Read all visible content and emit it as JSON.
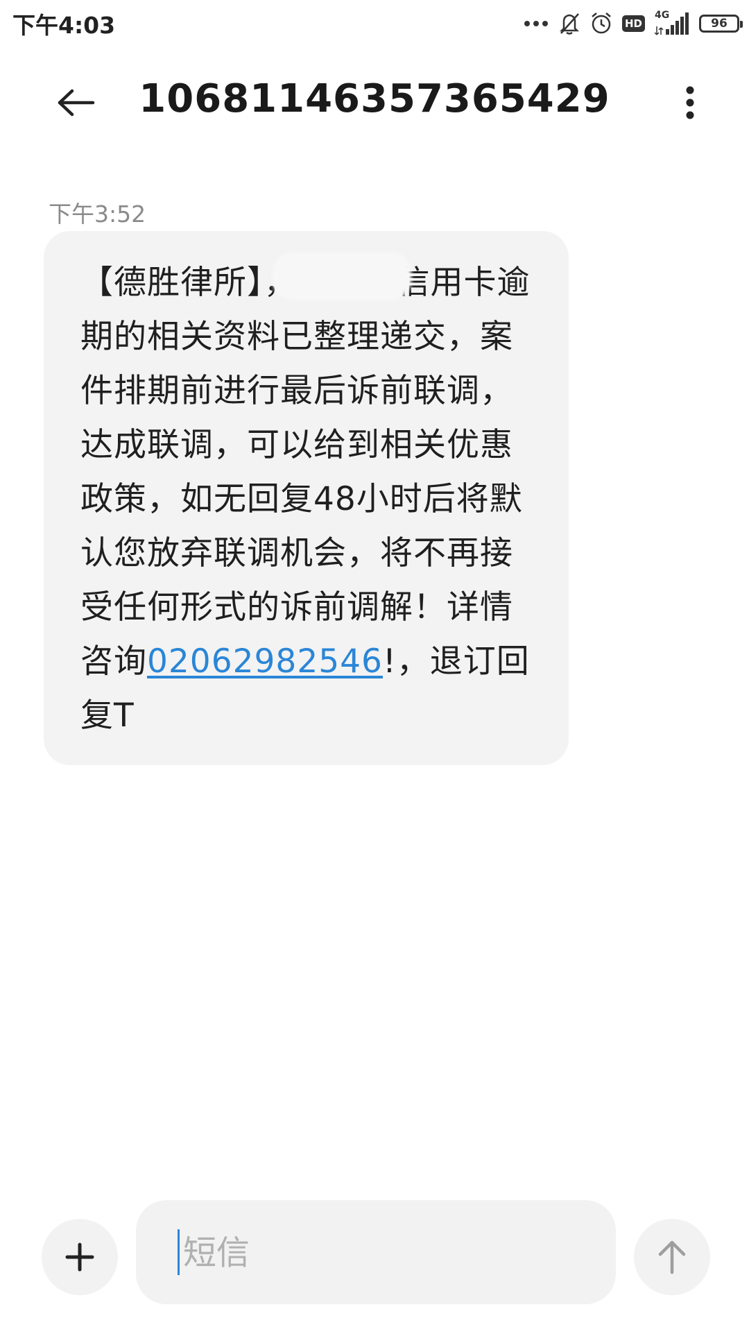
{
  "status_bar": {
    "time": "下午4:03",
    "network": "4G",
    "hd": "HD",
    "battery_text": "96",
    "battery_level": 0.96
  },
  "header": {
    "title": "10681146357365429",
    "back_icon": "arrow-left-icon",
    "more_icon": "more-vertical-icon"
  },
  "message": {
    "time": "下午3:52",
    "text_before_link": "【德胜律所】，关于您信用卡逾期的相关资料已整理递交，案件排期前进行最后诉前联调，达成联调，可以给到相关优惠政策，如无回复48小时后将默认您放弃联调机会，将不再接受任何形式的诉前调解！详情咨询",
    "phone_link": "02062982546",
    "text_after_link": "!，退订回复T"
  },
  "composer": {
    "placeholder": "短信",
    "value": "",
    "add_icon": "plus-icon",
    "send_icon": "arrow-up-icon"
  },
  "colors": {
    "link": "#2a86d6",
    "bubble_bg": "#f3f3f3",
    "caret": "#2a86d6"
  }
}
